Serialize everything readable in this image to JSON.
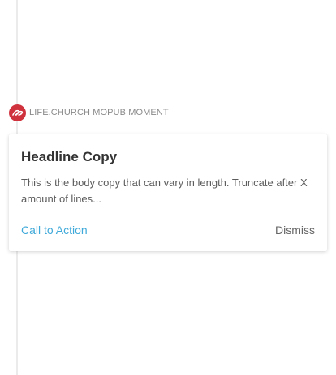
{
  "header": {
    "logo_icon": "lifechurch-logo-icon",
    "eyebrow_text": "LIFE.CHURCH MOPUB MOMENT"
  },
  "card": {
    "headline": "Headline Copy",
    "body": "This is the body copy that can vary in length. Truncate after X amount of lines...",
    "cta_label": "Call to Action",
    "dismiss_label": "Dismiss"
  },
  "colors": {
    "brand": "#d0323d",
    "cta": "#3fa9d9",
    "divider": "#ebebeb"
  }
}
